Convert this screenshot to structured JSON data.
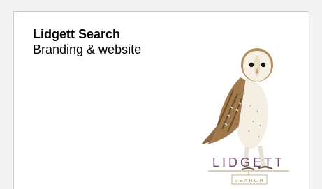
{
  "card": {
    "title": "Lidgett Search",
    "subtitle": "Branding & website"
  },
  "logo": {
    "icon": "barn-owl-illustration",
    "wordmark": "LIDGETT",
    "tagline": "SEARCH",
    "wordmark_color": "#6f4f6b",
    "rule_color": "#c4b48a"
  }
}
